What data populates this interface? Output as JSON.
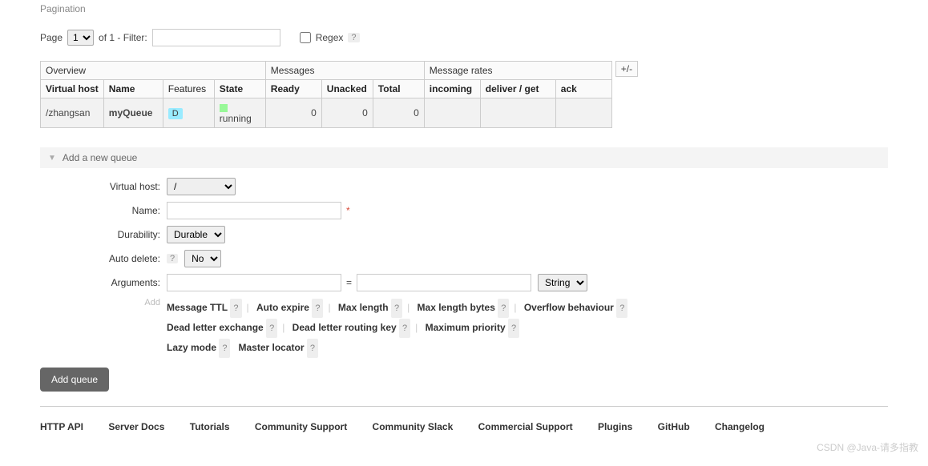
{
  "pagination": {
    "header": "Pagination",
    "page_label": "Page",
    "of_label": "of 1  - Filter:",
    "page_value": "1",
    "regex_label": "Regex",
    "help": "?"
  },
  "table": {
    "toggle": "+/-",
    "groups": {
      "overview": "Overview",
      "messages": "Messages",
      "rates": "Message rates"
    },
    "cols": {
      "vhost": "Virtual host",
      "name": "Name",
      "features": "Features",
      "state": "State",
      "ready": "Ready",
      "unacked": "Unacked",
      "total": "Total",
      "incoming": "incoming",
      "deliver": "deliver / get",
      "ack": "ack"
    },
    "row": {
      "vhost": "/zhangsan",
      "name": "myQueue",
      "feature_badge": "D",
      "state": "running",
      "ready": "0",
      "unacked": "0",
      "total": "0",
      "incoming": "",
      "deliver": "",
      "ack": ""
    }
  },
  "add": {
    "title": "Add a new queue",
    "labels": {
      "vhost": "Virtual host:",
      "name": "Name:",
      "durability": "Durability:",
      "autodel": "Auto delete:",
      "args": "Arguments:",
      "add": "Add"
    },
    "vhost_value": "/",
    "durability_value": "Durable",
    "autodel_value": "No",
    "arg_type": "String",
    "help": "?",
    "hints": {
      "ttl": "Message TTL",
      "expire": "Auto expire",
      "maxlen": "Max length",
      "maxlenb": "Max length bytes",
      "overflow": "Overflow behaviour",
      "dlx": "Dead letter exchange",
      "dlrk": "Dead letter routing key",
      "maxprio": "Maximum priority",
      "lazy": "Lazy mode",
      "master": "Master locator"
    },
    "button": "Add queue"
  },
  "footer": {
    "api": "HTTP API",
    "docs": "Server Docs",
    "tut": "Tutorials",
    "csup": "Community Support",
    "cslack": "Community Slack",
    "comm": "Commercial Support",
    "plugins": "Plugins",
    "github": "GitHub",
    "changelog": "Changelog"
  },
  "watermark": "CSDN @Java-请多指教"
}
